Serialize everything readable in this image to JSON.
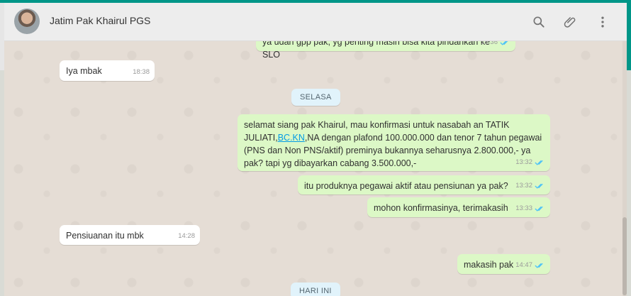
{
  "header": {
    "contact_name": "Jatim Pak Khairul PGS",
    "icons": [
      "search-icon",
      "attach-icon",
      "menu-icon"
    ]
  },
  "messages": [
    {
      "dir": "out",
      "text": "ya udah gpp pak, yg penting masih bisa kita pindahkan ke SLO",
      "time": "18:36",
      "ticks": "read"
    },
    {
      "dir": "in",
      "text": "Iya mbak",
      "time": "18:38"
    },
    {
      "dir": "out",
      "text_before": "selamat siang pak Khairul, mau konfirmasi untuk nasabah an TATIK JULIATI,",
      "link": "BC.KN",
      "text_after": ",NA dengan plafond 100.000.000 dan tenor 7 tahun pegawai (PNS dan Non PNS/aktif) preminya bukannya seharusnya 2.800.000,- ya pak? tapi yg dibayarkan cabang 3.500.000,-",
      "time": "13:32",
      "ticks": "read"
    },
    {
      "dir": "out",
      "text": "itu produknya pegawai aktif atau pensiunan ya pak?",
      "time": "13:32",
      "ticks": "read"
    },
    {
      "dir": "out",
      "text": "mohon konfirmasinya, terimakasih",
      "time": "13:33",
      "ticks": "read"
    },
    {
      "dir": "in",
      "text": "Pensiuanan itu mbk",
      "time": "14:28"
    },
    {
      "dir": "out",
      "text": "makasih pak",
      "time": "14:47",
      "ticks": "read"
    }
  ],
  "dates": {
    "d1": "SELASA",
    "d2": "HARI INI"
  },
  "colors": {
    "accent": "#009688",
    "outgoing_bubble": "#dcf8c6",
    "incoming_bubble": "#ffffff",
    "read_tick": "#4fc3f7"
  }
}
